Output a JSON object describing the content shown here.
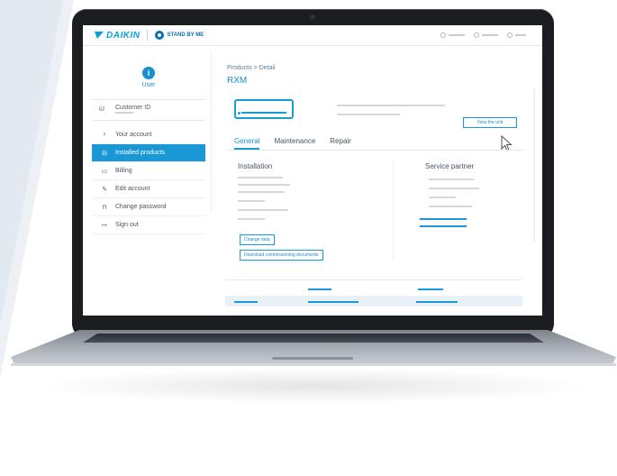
{
  "brand": {
    "name": "DAIKIN",
    "product": "STAND BY ME"
  },
  "sidebar": {
    "user_label": "User",
    "customer_id_label": "Customer ID",
    "items": [
      {
        "label": "Your account",
        "icon": "user-icon"
      },
      {
        "label": "Installed products",
        "icon": "product-icon",
        "active": true
      },
      {
        "label": "Billing",
        "icon": "card-icon"
      },
      {
        "label": "Edit account",
        "icon": "edit-icon"
      },
      {
        "label": "Change password",
        "icon": "lock-icon"
      },
      {
        "label": "Sign out",
        "icon": "signout-icon"
      }
    ]
  },
  "main": {
    "breadcrumb": "Products > Detail",
    "title": "RXM",
    "view_unit_label": "View the unit",
    "tabs": [
      "General",
      "Maintenance",
      "Repair"
    ],
    "installation_title": "Installation",
    "service_partner_title": "Service partner",
    "change_data_label": "Change data",
    "download_docs_label": "Download commissioning documents"
  },
  "colors": {
    "accent": "#1a9ad8",
    "lid": "#1b1d20",
    "background_panel": "#edf1f6"
  }
}
